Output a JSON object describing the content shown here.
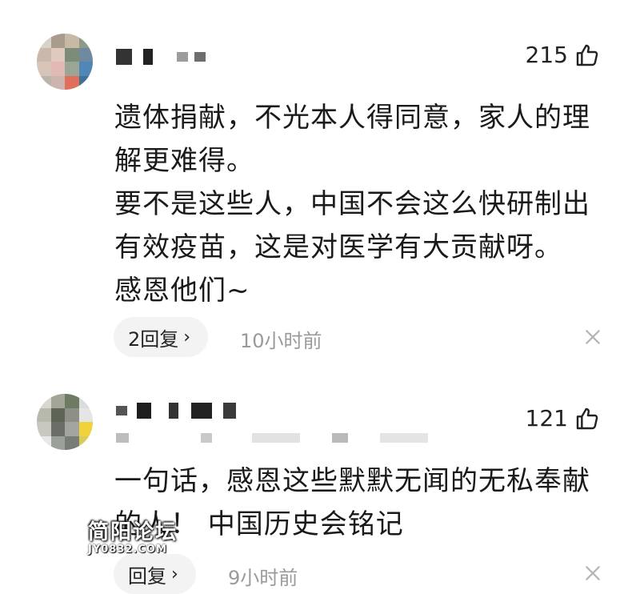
{
  "comments": [
    {
      "likes": "215",
      "text_lines": [
        "遗体捐献，不光本人得同意，家人的理",
        "解更难得。",
        "要不是这些人，中国不会这么快研制出",
        "有效疫苗，这是对医学有大贡献呀。",
        "感恩他们~"
      ],
      "reply_label": "2回复",
      "time": "10小时前"
    },
    {
      "likes": "121",
      "text_lines": [
        "一句话，感恩这些默默无闻的无私奉献",
        "的人！ 中国历史会铭记"
      ],
      "reply_label": "回复",
      "time": "9小时前"
    }
  ],
  "icons": {
    "like": "thumbs-up-icon",
    "reply_chevron": "chevron-right-icon",
    "dismiss": "close-icon"
  },
  "watermark": {
    "name": "简阳论坛",
    "site": "JY0832.COM"
  },
  "colors": {
    "text": "#1a1a1a",
    "muted": "#9a9a9a",
    "pill_bg": "#f3f3f3"
  }
}
